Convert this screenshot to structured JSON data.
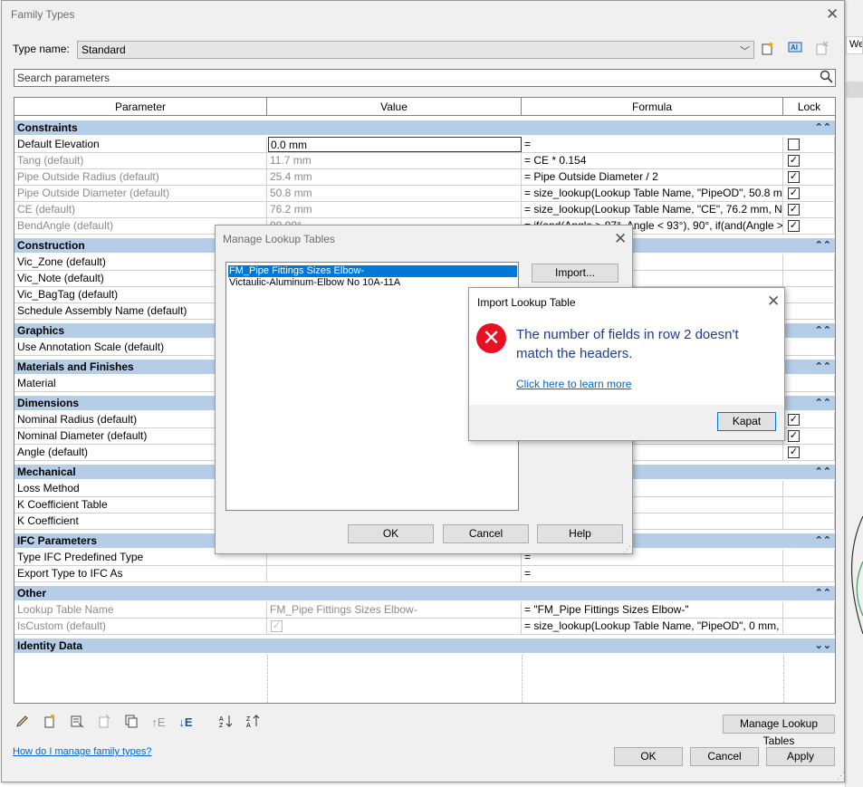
{
  "family_types": {
    "title": "Family Types",
    "type_name_label": "Type name:",
    "type_name_value": "Standard",
    "search_placeholder": "Search parameters",
    "columns": [
      "Parameter",
      "Value",
      "Formula",
      "Lock"
    ],
    "sections": {
      "constraints": "Constraints",
      "construction": "Construction",
      "graphics": "Graphics",
      "materials": "Materials and Finishes",
      "dimensions": "Dimensions",
      "mechanical": "Mechanical",
      "ifc": "IFC Parameters",
      "other": "Other",
      "identity": "Identity Data"
    },
    "rows": {
      "default_elevation": {
        "param": "Default Elevation",
        "value": "0.0 mm",
        "formula": "="
      },
      "tang": {
        "param": "Tang (default)",
        "value": "11.7 mm",
        "formula": "= CE * 0.154"
      },
      "pipe_or": {
        "param": "Pipe Outside Radius (default)",
        "value": "25.4 mm",
        "formula": "= Pipe Outside Diameter / 2"
      },
      "pipe_od": {
        "param": "Pipe Outside Diameter (default)",
        "value": "50.8 mm",
        "formula": "= size_lookup(Lookup Table Name, \"PipeOD\", 50.8 m"
      },
      "ce": {
        "param": "CE (default)",
        "value": "76.2 mm",
        "formula": "= size_lookup(Lookup Table Name, \"CE\", 76.2 mm, No"
      },
      "bend": {
        "param": "BendAngle (default)",
        "value": "90.00°",
        "formula": "= if(and(Angle > 87°, Angle < 93°), 90°, if(and(Angle >"
      },
      "vic_zone": {
        "param": "Vic_Zone (default)"
      },
      "vic_note": {
        "param": "Vic_Note (default)"
      },
      "vic_bagtag": {
        "param": "Vic_BagTag (default)"
      },
      "schedule": {
        "param": "Schedule Assembly Name (default)"
      },
      "annotation": {
        "param": "Use Annotation Scale (default)"
      },
      "material": {
        "param": "Material"
      },
      "nom_radius": {
        "param": "Nominal Radius (default)"
      },
      "nom_diameter": {
        "param": "Nominal Diameter (default)"
      },
      "angle": {
        "param": "Angle (default)"
      },
      "loss": {
        "param": "Loss Method"
      },
      "kcoef_table": {
        "param": "K Coefficient Table"
      },
      "kcoef": {
        "param": "K Coefficient"
      },
      "ifc_type": {
        "param": "Type IFC Predefined Type",
        "formula": "="
      },
      "ifc_export": {
        "param": "Export Type to IFC As",
        "formula": "="
      },
      "lookup": {
        "param": "Lookup Table Name",
        "value": "FM_Pipe Fittings Sizes Elbow-",
        "formula": "= \"FM_Pipe Fittings Sizes Elbow-\""
      },
      "iscustom": {
        "param": "IsCustom (default)",
        "formula": "= size_lookup(Lookup Table Name, \"PipeOD\", 0 mm,"
      }
    },
    "manage_lookup_button": "Manage Lookup Tables",
    "help_link": "How do I manage family types?",
    "ok": "OK",
    "cancel": "Cancel",
    "apply": "Apply"
  },
  "manage_lookup": {
    "title": "Manage Lookup Tables",
    "items": [
      "FM_Pipe Fittings Sizes Elbow-",
      "Victaulic-Aluminum-Elbow No 10A-11A"
    ],
    "import": "Import...",
    "ok": "OK",
    "cancel": "Cancel",
    "help": "Help"
  },
  "import_dialog": {
    "title": "Import Lookup Table",
    "message": "The number of fields in row 2 doesn't match the headers.",
    "link": "Click here to learn more",
    "close": "Kapat"
  },
  "background": {
    "tab_label": "We"
  },
  "colors": {
    "section_bg": "#b5cde6",
    "selection": "#0078d7",
    "error": "#e81123",
    "link": "#0066cc"
  }
}
